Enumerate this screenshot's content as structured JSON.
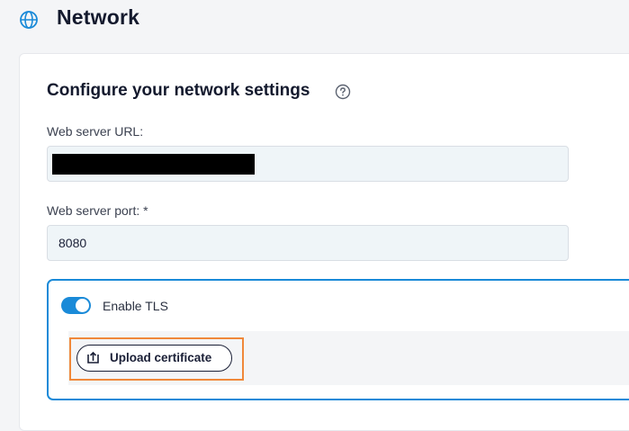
{
  "header": {
    "title": "Network",
    "icon": "globe-icon"
  },
  "section": {
    "title": "Configure your network settings",
    "help_icon": "help-circle-icon"
  },
  "fields": {
    "url": {
      "label": "Web server URL:",
      "value": ""
    },
    "port": {
      "label": "Web server port: *",
      "value": "8080"
    }
  },
  "tls": {
    "enabled": true,
    "label": "Enable TLS",
    "upload_button": "Upload certificate",
    "upload_icon": "upload-icon"
  },
  "colors": {
    "accent": "#1a8ad8",
    "highlight": "#f0883a",
    "input_bg": "#eff5f8"
  }
}
